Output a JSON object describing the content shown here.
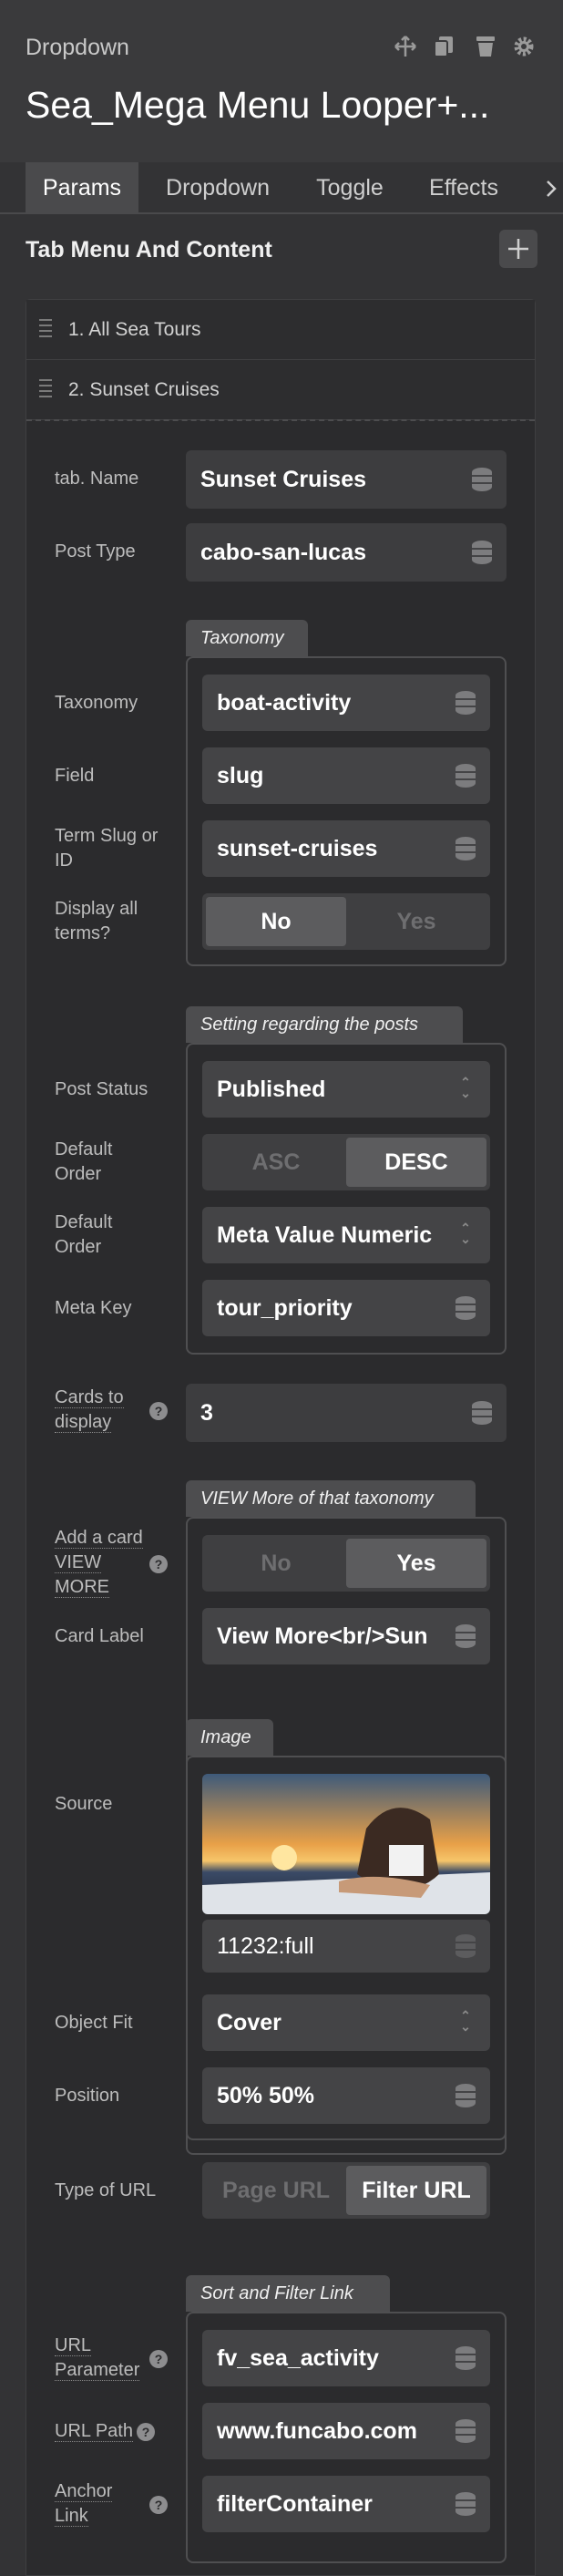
{
  "header": {
    "kind": "Dropdown",
    "title": "Sea_Mega Menu Looper+...",
    "icons": [
      "move-icon",
      "copy-icon",
      "trash-icon",
      "gear-icon"
    ]
  },
  "tabs": [
    {
      "label": "Params",
      "active": true
    },
    {
      "label": "Dropdown"
    },
    {
      "label": "Toggle"
    },
    {
      "label": "Effects"
    }
  ],
  "section": {
    "title": "Tab Menu And Content",
    "add_icon": "plus-icon"
  },
  "items": [
    "1. All Sea Tours",
    "2. Sunset Cruises"
  ],
  "fields": {
    "tab_name": {
      "label": "tab. Name",
      "value": "Sunset Cruises"
    },
    "post_type": {
      "label": "Post Type",
      "value": "cabo-san-lucas"
    },
    "taxonomy_group": "Taxonomy",
    "taxonomy": {
      "label": "Taxonomy",
      "value": "boat-activity"
    },
    "field": {
      "label": "Field",
      "value": "slug"
    },
    "term": {
      "label": "Term Slug or ID",
      "value": "sunset-cruises"
    },
    "display_all": {
      "label": "Display all terms?",
      "options": [
        "No",
        "Yes"
      ],
      "selected": "No"
    },
    "posts_group": "Setting regarding the posts",
    "post_status": {
      "label": "Post Status",
      "value": "Published"
    },
    "order1": {
      "label": "Default Order",
      "options": [
        "ASC",
        "DESC"
      ],
      "selected": "DESC"
    },
    "order2": {
      "label": "Default Order",
      "value": "Meta Value Numeric"
    },
    "meta_key": {
      "label": "Meta Key",
      "value": "tour_priority"
    },
    "cards": {
      "label": "Cards to display",
      "value": "3"
    },
    "view_group": "VIEW More of that taxonomy",
    "add_card": {
      "label": "Add a card VIEW MORE",
      "options": [
        "No",
        "Yes"
      ],
      "selected": "Yes"
    },
    "card_label": {
      "label": "Card Label",
      "value": "View More<br/>Sun"
    },
    "image_group": "Image",
    "source": {
      "label": "Source",
      "value": "11232:full"
    },
    "object_fit": {
      "label": "Object Fit",
      "value": "Cover"
    },
    "position": {
      "label": "Position",
      "value": "50% 50%"
    },
    "url_type": {
      "label": "Type of URL",
      "options": [
        "Page URL",
        "Filter URL"
      ],
      "selected": "Filter URL"
    },
    "sort_group": "Sort and Filter Link",
    "url_param": {
      "label": "URL Parameter",
      "value": "fv_sea_activity"
    },
    "url_path": {
      "label": "URL Path",
      "value": "www.funcabo.com"
    },
    "anchor": {
      "label": "Anchor Link",
      "value": "filterContainer"
    }
  },
  "help_char": "?",
  "colors": {
    "bg": "#333335",
    "field": "#3d3d3f",
    "selected": "#5c5c5e"
  }
}
